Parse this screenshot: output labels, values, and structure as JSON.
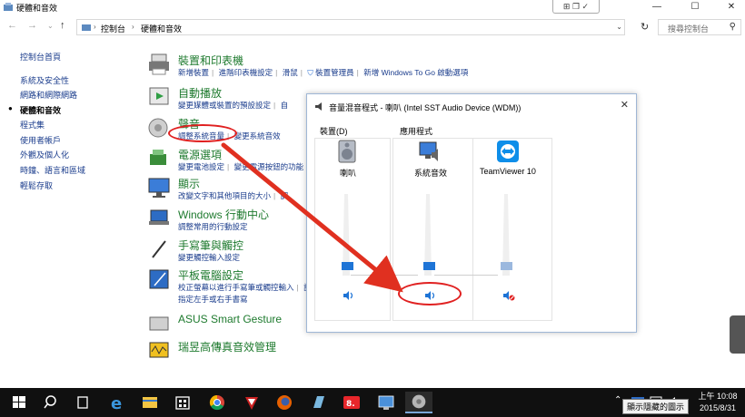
{
  "window": {
    "title": "硬體和音效",
    "min": "—",
    "max": "☐",
    "close": "✕",
    "notif_icons": [
      "⊞",
      "❐",
      "✓"
    ]
  },
  "address": {
    "crumbs": [
      "控制台",
      "硬體和音效"
    ],
    "search_placeholder": "搜尋控制台"
  },
  "leftnav": {
    "home": "控制台首頁",
    "items": [
      {
        "label": "系統及安全性",
        "active": false
      },
      {
        "label": "網路和網際網路",
        "active": false
      },
      {
        "label": "硬體和音效",
        "active": true
      },
      {
        "label": "程式集",
        "active": false
      },
      {
        "label": "使用者帳戶",
        "active": false
      },
      {
        "label": "外觀及個人化",
        "active": false
      },
      {
        "label": "時鐘、語言和區域",
        "active": false
      },
      {
        "label": "輕鬆存取",
        "active": false
      }
    ]
  },
  "categories": [
    {
      "title": "裝置和印表機",
      "icon": "printer-icon",
      "lines": [
        [
          "新增裝置",
          "進階印表機設定",
          "滑鼠",
          "裝置管理員",
          "新增 Windows To Go 啟動選項"
        ]
      ]
    },
    {
      "title": "自動播放",
      "icon": "autoplay-icon",
      "lines": [
        [
          "變更媒體或裝置的預設設定",
          "自"
        ]
      ]
    },
    {
      "title": "聲音",
      "icon": "speaker-icon",
      "lines": [
        [
          "調整系統音量",
          "變更系統音效"
        ]
      ]
    },
    {
      "title": "電源選項",
      "icon": "power-icon",
      "lines": [
        [
          "變更電池設定",
          "變更電源按鈕的功能",
          "需"
        ]
      ]
    },
    {
      "title": "顯示",
      "icon": "monitor-icon",
      "lines": [
        [
          "改變文字和其他項目的大小",
          "調"
        ]
      ]
    },
    {
      "title": "Windows 行動中心",
      "icon": "mobility-icon",
      "lines": [
        [
          "調整常用的行動設定"
        ]
      ]
    },
    {
      "title": "手寫筆與觸控",
      "icon": "pen-icon",
      "lines": [
        [
          "變更觸控輸入設定"
        ]
      ]
    },
    {
      "title": "平板電腦設定",
      "icon": "tablet-icon",
      "lines": [
        [
          "校正螢幕以進行手寫筆或觸控輸入",
          "設"
        ],
        [
          "指定左手或右手書寫"
        ]
      ]
    },
    {
      "title": "ASUS Smart Gesture",
      "icon": "touchpad-icon",
      "lines": []
    },
    {
      "title": "瑞昱高傳真音效管理",
      "icon": "realtek-icon",
      "lines": []
    }
  ],
  "mixer": {
    "title": "音量混音程式 - 喇叭 (Intel SST Audio Device (WDM))",
    "device_group": "裝置(D)",
    "apps_group": "應用程式",
    "channels": [
      {
        "name": "喇叭",
        "icon": "speaker-device-icon",
        "level": 0.12,
        "muted": false
      },
      {
        "name": "系統音效",
        "icon": "system-sounds-icon",
        "level": 0.12,
        "muted": false
      },
      {
        "name": "TeamViewer 10",
        "icon": "teamviewer-icon",
        "level": 0.12,
        "muted": true
      }
    ]
  },
  "taskbar": {
    "apps": [
      "windows-start-icon",
      "search-icon",
      "task-view-icon",
      "edge-icon",
      "file-explorer-icon",
      "store-icon",
      "chrome-icon",
      "game-icon",
      "firefox-icon",
      "app-icon",
      "eight-app-icon",
      "remote-icon",
      "volume-app-icon"
    ],
    "clock_time": "上午 10:08",
    "clock_date": "2015/8/31",
    "tooltip": "顯示隱藏的圖示"
  },
  "colors": {
    "accent": "#1e74d6",
    "category_title": "#1e7a2e",
    "link": "#1a3c8c",
    "annotation": "#e02020"
  }
}
